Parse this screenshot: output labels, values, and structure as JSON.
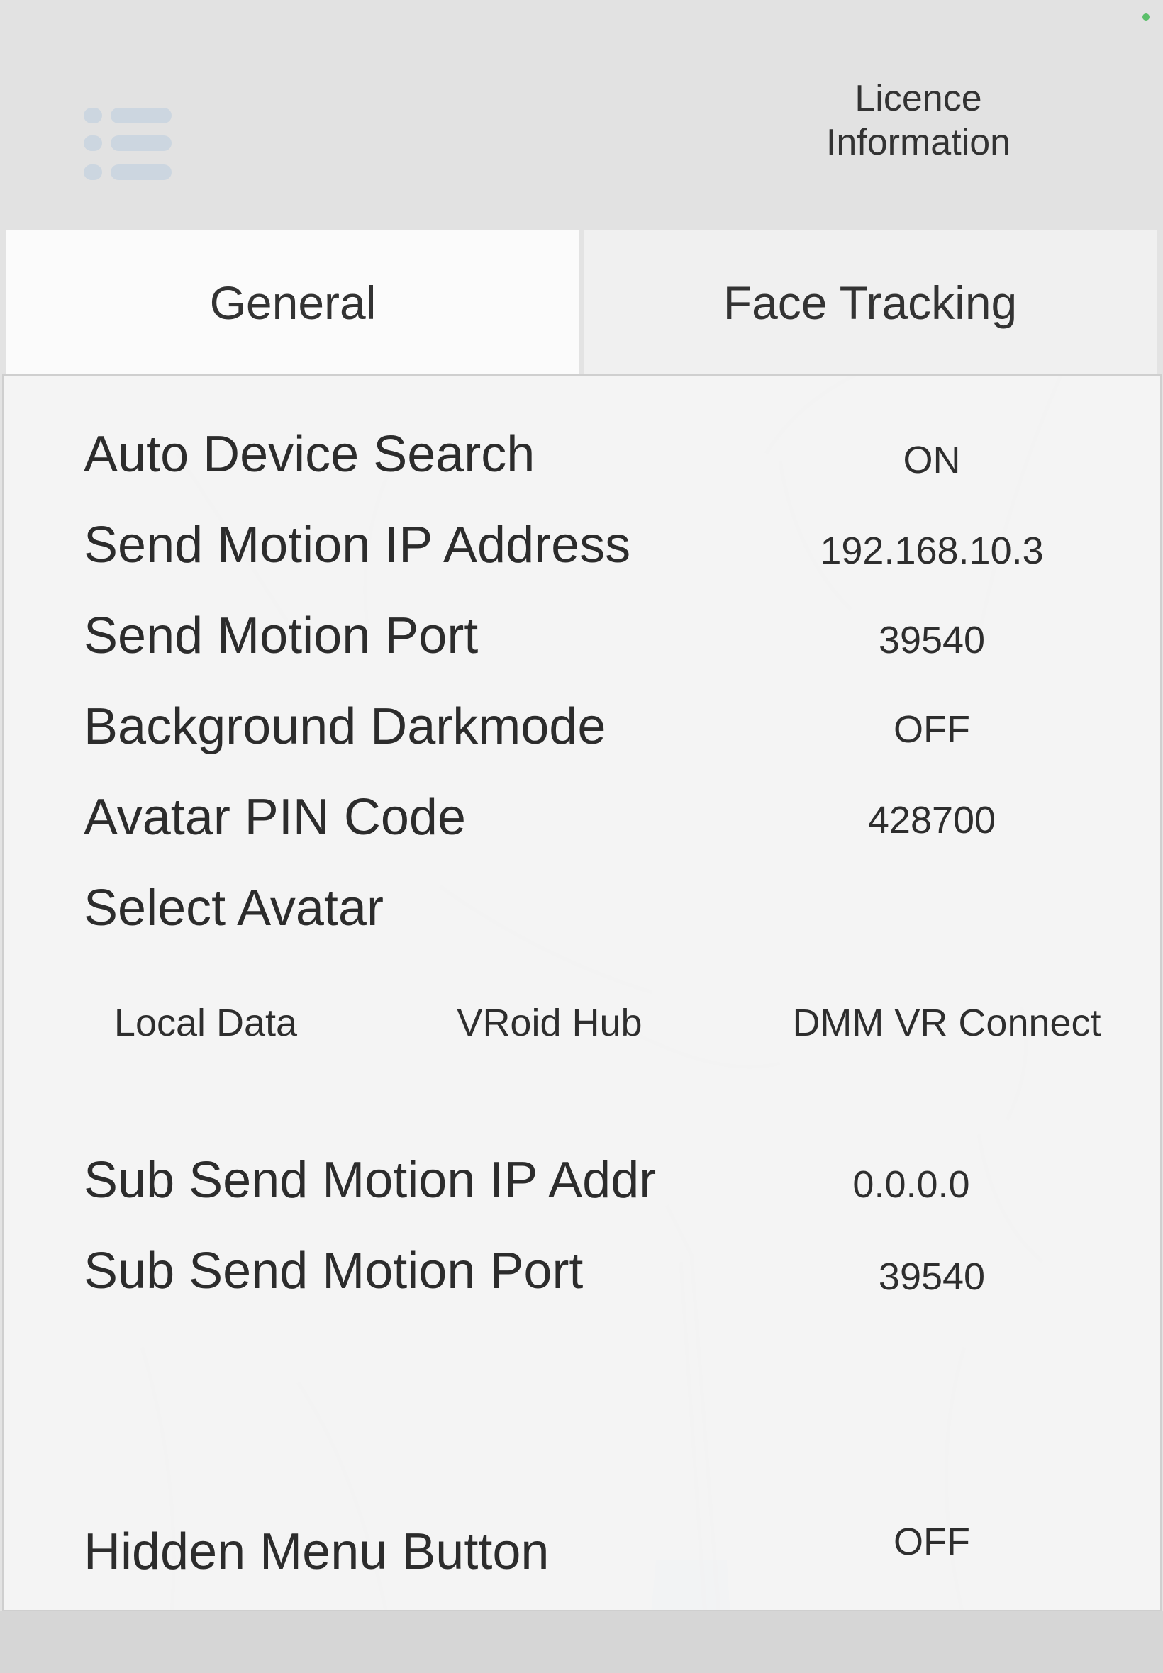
{
  "header": {
    "licence_label": "Licence\nInformation"
  },
  "tabs": [
    {
      "label": "General",
      "active": true
    },
    {
      "label": "Face Tracking",
      "active": false
    }
  ],
  "settings": {
    "auto_device_search": {
      "label": "Auto Device Search",
      "value": "ON"
    },
    "send_motion_ip": {
      "label": "Send Motion IP Address",
      "value": "192.168.10.3"
    },
    "send_motion_port": {
      "label": "Send Motion Port",
      "value": "39540"
    },
    "background_darkmode": {
      "label": "Background Darkmode",
      "value": "OFF"
    },
    "avatar_pin": {
      "label": "Avatar PIN Code",
      "value": "428700"
    },
    "select_avatar": {
      "label": "Select Avatar",
      "options": [
        "Local Data",
        "VRoid Hub",
        "DMM VR Connect"
      ]
    },
    "sub_send_motion_ip": {
      "label": "Sub Send Motion IP Addr",
      "value": "0.0.0.0"
    },
    "sub_send_motion_port": {
      "label": "Sub Send Motion Port",
      "value": "39540"
    },
    "hidden_menu_button": {
      "label": "Hidden Menu Button",
      "value": "OFF"
    }
  },
  "colors": {
    "status_dot": "#5bbf6a",
    "menu_icon": "#ccd6e0",
    "active_tab": "#fbfbfb",
    "inactive_tab": "#f0f0f0"
  }
}
